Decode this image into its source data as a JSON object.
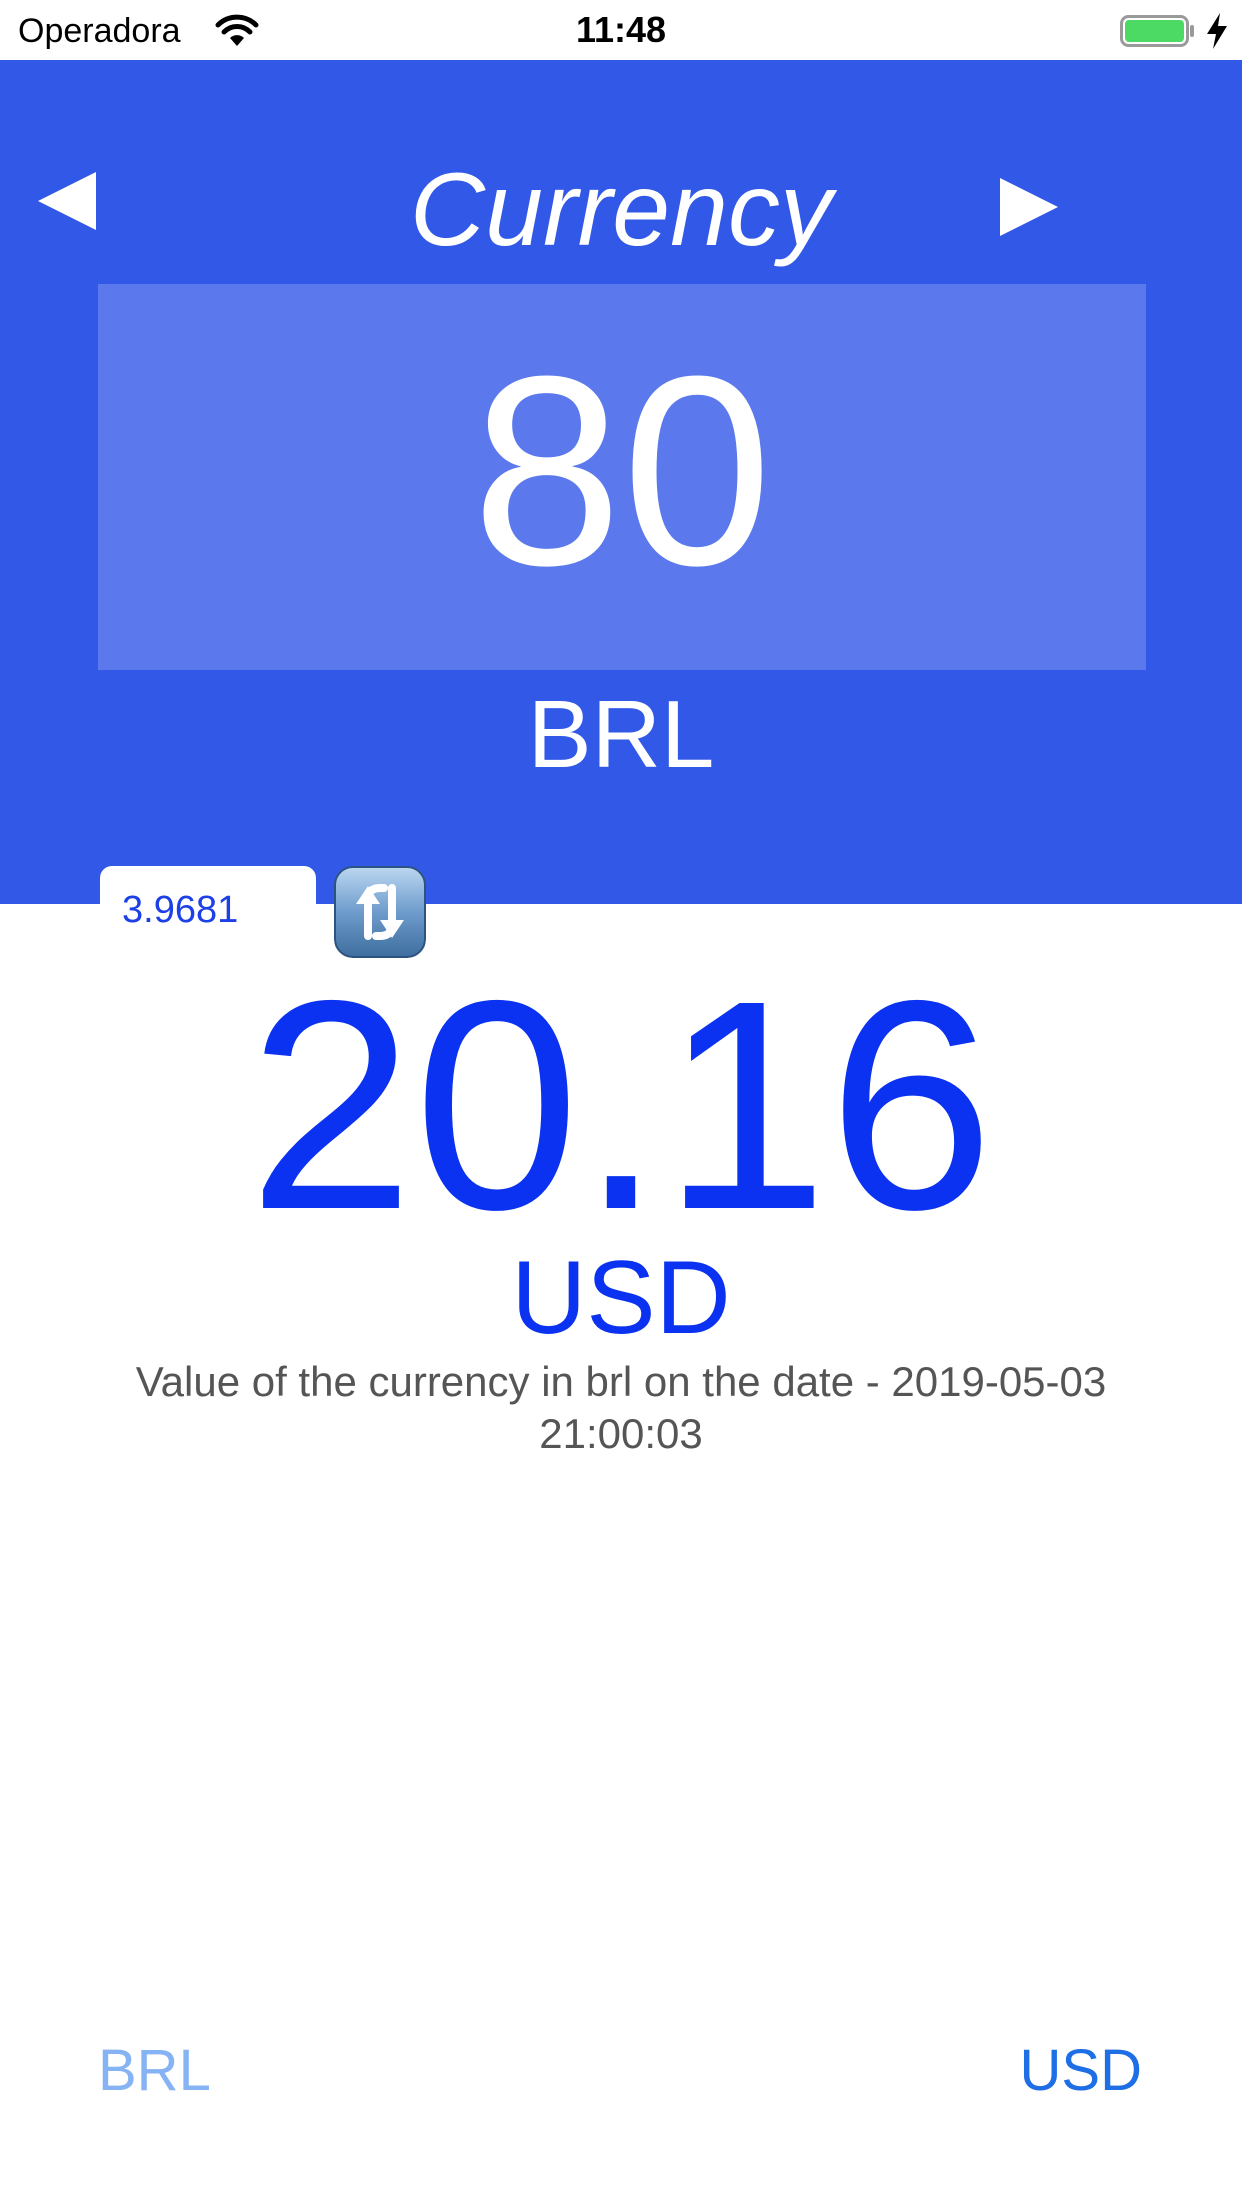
{
  "status_bar": {
    "carrier": "Operadora",
    "time": "11:48",
    "wifi_icon": "wifi-icon",
    "battery_icon": "battery-charging-icon"
  },
  "colors": {
    "brand_blue": "#3258e8",
    "result_blue": "#0a32f0",
    "muted_text": "#555555",
    "battery_green": "#4cd964"
  },
  "header": {
    "title": "Currency",
    "prev_icon": "left-triangle-icon",
    "next_icon": "right-triangle-icon"
  },
  "converter": {
    "input_value": "80",
    "from_currency": "BRL",
    "rate": "3.9681",
    "refresh_icon": "refresh-arrows-icon",
    "result_value": "20.16",
    "to_currency": "USD",
    "rate_note": "Value of the currency in brl on the date - 2019-05-03 21:00:03"
  },
  "selector": {
    "from_label": "BRL",
    "to_label": "USD"
  }
}
